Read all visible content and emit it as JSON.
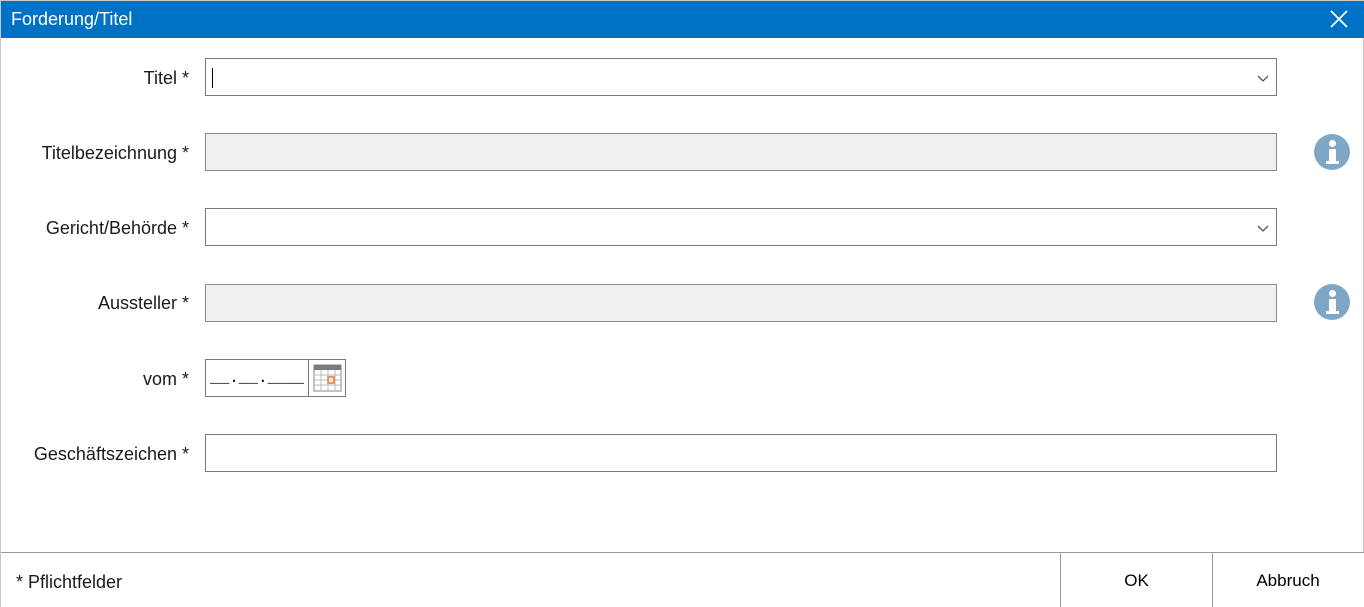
{
  "window": {
    "title": "Forderung/Titel",
    "titlebar_color": "#0072c6",
    "close_icon": "close-icon"
  },
  "form": {
    "titel": {
      "label": "Titel *",
      "value": ""
    },
    "titelbezeichnung": {
      "label": "Titelbezeichnung *",
      "value": ""
    },
    "gericht": {
      "label": "Gericht/Behörde *",
      "value": ""
    },
    "aussteller": {
      "label": "Aussteller *",
      "value": ""
    },
    "vom": {
      "label": "vom *",
      "value": "__.__.____"
    },
    "geschaeftszeichen": {
      "label": "Geschäftszeichen *",
      "value": ""
    }
  },
  "icons": {
    "info": "info-icon",
    "calendar": "calendar-icon",
    "dropdown": "chevron-down-icon"
  },
  "footer": {
    "note": "* Pflichtfelder",
    "ok_label": "OK",
    "cancel_label": "Abbruch"
  }
}
